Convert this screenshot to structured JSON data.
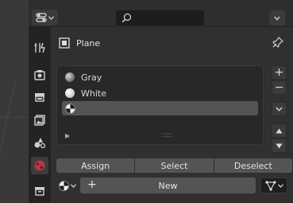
{
  "header": {
    "editor_type_icon": "properties-editor-icon",
    "search_value": "",
    "options_icon": "chevron-down-icon"
  },
  "tabs": [
    {
      "name": "tool-icon"
    },
    {
      "name": "render-icon"
    },
    {
      "name": "output-icon"
    },
    {
      "name": "view-layer-icon"
    },
    {
      "name": "scene-icon"
    },
    {
      "name": "world-icon",
      "active": true
    },
    {
      "name": "collection-icon"
    }
  ],
  "object": {
    "name": "Plane",
    "icon": "mesh-plane-icon",
    "pin_icon": "pin-icon"
  },
  "material_slots": [
    {
      "label": "Gray",
      "icon": "material-gray-icon"
    },
    {
      "label": "White",
      "icon": "material-white-icon"
    },
    {
      "label": "",
      "icon": "material-checker-icon",
      "selected": true
    }
  ],
  "slot_controls": {
    "add": "+",
    "remove": "−"
  },
  "assign_row": {
    "assign": "Assign",
    "select": "Select",
    "deselect": "Deselect"
  },
  "datablock": {
    "new_label": "New",
    "plus": "+"
  },
  "colors": {
    "panel_bg": "#303030",
    "button_bg": "#545454",
    "selected_row": "#545454",
    "text": "#dcdcdc"
  }
}
